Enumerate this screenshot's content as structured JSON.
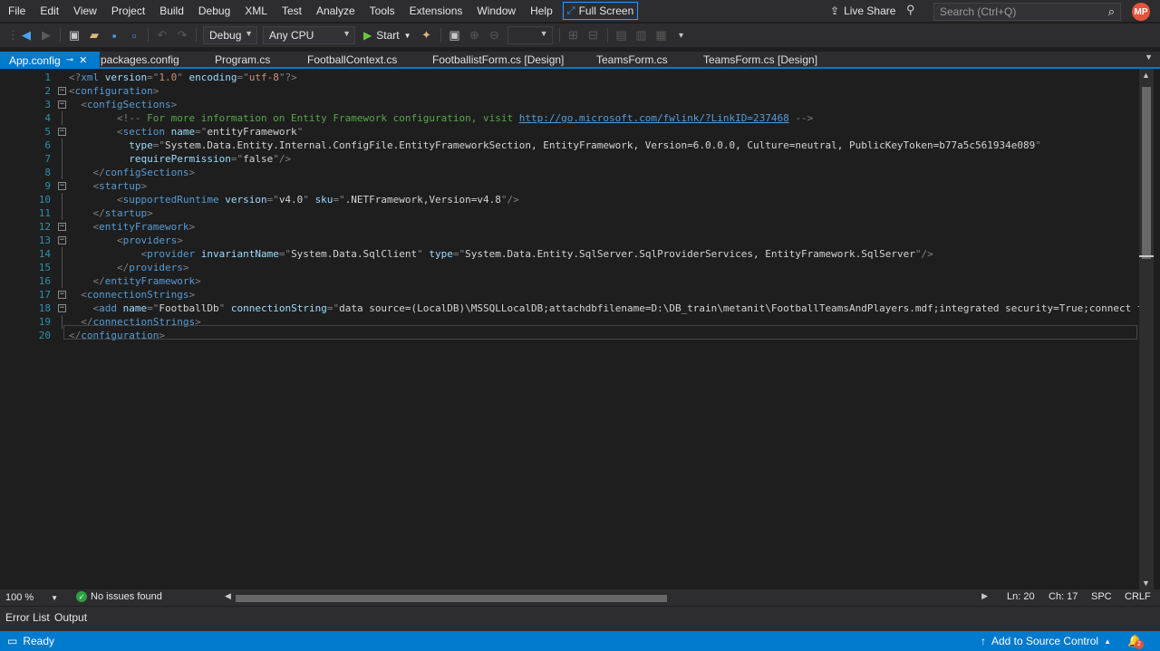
{
  "menu": {
    "items": [
      "File",
      "Edit",
      "View",
      "Project",
      "Build",
      "Debug",
      "XML",
      "Test",
      "Analyze",
      "Tools",
      "Extensions",
      "Window",
      "Help"
    ],
    "fullscreen": "Full Screen"
  },
  "liveshare": "Live Share",
  "search": {
    "placeholder": "Search (Ctrl+Q)"
  },
  "avatar": "MP",
  "toolbar": {
    "config": "Debug",
    "platform": "Any CPU",
    "start": "Start"
  },
  "tabs": [
    "App.config",
    "packages.config",
    "Program.cs",
    "FootballContext.cs",
    "FootballistForm.cs [Design]",
    "TeamsForm.cs",
    "TeamsForm.cs [Design]"
  ],
  "editor": {
    "lines": [
      [
        [
          "br",
          "<?"
        ],
        [
          "tag",
          "xml"
        ],
        [
          "pl",
          " "
        ],
        [
          "at",
          "version"
        ],
        [
          "br",
          "=\""
        ],
        [
          "vl",
          "1.0"
        ],
        [
          "br",
          "\" "
        ],
        [
          "at",
          "encoding"
        ],
        [
          "br",
          "=\""
        ],
        [
          "vl",
          "utf-8"
        ],
        [
          "br",
          "\"?>"
        ]
      ],
      [
        [
          "br",
          "<"
        ],
        [
          "tag",
          "configuration"
        ],
        [
          "br",
          ">"
        ]
      ],
      [
        [
          "pl",
          "  "
        ],
        [
          "br",
          "<"
        ],
        [
          "tag",
          "configSections"
        ],
        [
          "br",
          ">"
        ]
      ],
      [
        [
          "pl",
          "        "
        ],
        [
          "br",
          "<!-- "
        ],
        [
          "cm",
          "For more information on Entity Framework configuration, visit "
        ],
        [
          "lk",
          "http://go.microsoft.com/fwlink/?LinkID=237468"
        ],
        [
          "br",
          " -->"
        ]
      ],
      [
        [
          "pl",
          "        "
        ],
        [
          "br",
          "<"
        ],
        [
          "tag",
          "section"
        ],
        [
          "pl",
          " "
        ],
        [
          "at",
          "name"
        ],
        [
          "br",
          "=\""
        ],
        [
          "pl",
          "entityFramework"
        ],
        [
          "br",
          "\""
        ]
      ],
      [
        [
          "pl",
          "          "
        ],
        [
          "at",
          "type"
        ],
        [
          "br",
          "=\""
        ],
        [
          "pl",
          "System.Data.Entity.Internal.ConfigFile.EntityFrameworkSection, EntityFramework, Version=6.0.0.0, Culture=neutral, PublicKeyToken=b77a5c561934e089"
        ],
        [
          "br",
          "\""
        ]
      ],
      [
        [
          "pl",
          "          "
        ],
        [
          "at",
          "requirePermission"
        ],
        [
          "br",
          "=\""
        ],
        [
          "pl",
          "false"
        ],
        [
          "br",
          "\"/>"
        ]
      ],
      [
        [
          "pl",
          "    "
        ],
        [
          "br",
          "</"
        ],
        [
          "tag",
          "configSections"
        ],
        [
          "br",
          ">"
        ]
      ],
      [
        [
          "pl",
          "    "
        ],
        [
          "br",
          "<"
        ],
        [
          "tag",
          "startup"
        ],
        [
          "br",
          ">"
        ]
      ],
      [
        [
          "pl",
          "        "
        ],
        [
          "br",
          "<"
        ],
        [
          "tag",
          "supportedRuntime"
        ],
        [
          "pl",
          " "
        ],
        [
          "at",
          "version"
        ],
        [
          "br",
          "=\""
        ],
        [
          "pl",
          "v4.0"
        ],
        [
          "br",
          "\" "
        ],
        [
          "at",
          "sku"
        ],
        [
          "br",
          "=\""
        ],
        [
          "pl",
          ".NETFramework,Version=v4.8"
        ],
        [
          "br",
          "\"/>"
        ]
      ],
      [
        [
          "pl",
          "    "
        ],
        [
          "br",
          "</"
        ],
        [
          "tag",
          "startup"
        ],
        [
          "br",
          ">"
        ]
      ],
      [
        [
          "pl",
          "    "
        ],
        [
          "br",
          "<"
        ],
        [
          "tag",
          "entityFramework"
        ],
        [
          "br",
          ">"
        ]
      ],
      [
        [
          "pl",
          "        "
        ],
        [
          "br",
          "<"
        ],
        [
          "tag",
          "providers"
        ],
        [
          "br",
          ">"
        ]
      ],
      [
        [
          "pl",
          "            "
        ],
        [
          "br",
          "<"
        ],
        [
          "tag",
          "provider"
        ],
        [
          "pl",
          " "
        ],
        [
          "at",
          "invariantName"
        ],
        [
          "br",
          "=\""
        ],
        [
          "pl",
          "System.Data.SqlClient"
        ],
        [
          "br",
          "\" "
        ],
        [
          "at",
          "type"
        ],
        [
          "br",
          "=\""
        ],
        [
          "pl",
          "System.Data.Entity.SqlServer.SqlProviderServices, EntityFramework.SqlServer"
        ],
        [
          "br",
          "\"/>"
        ]
      ],
      [
        [
          "pl",
          "        "
        ],
        [
          "br",
          "</"
        ],
        [
          "tag",
          "providers"
        ],
        [
          "br",
          ">"
        ]
      ],
      [
        [
          "pl",
          "    "
        ],
        [
          "br",
          "</"
        ],
        [
          "tag",
          "entityFramework"
        ],
        [
          "br",
          ">"
        ]
      ],
      [
        [
          "pl",
          "  "
        ],
        [
          "br",
          "<"
        ],
        [
          "tag",
          "connectionStrings"
        ],
        [
          "br",
          ">"
        ]
      ],
      [
        [
          "pl",
          "    "
        ],
        [
          "br",
          "<"
        ],
        [
          "tag",
          "add"
        ],
        [
          "pl",
          " "
        ],
        [
          "at",
          "name"
        ],
        [
          "br",
          "=\""
        ],
        [
          "pl",
          "FootballDb"
        ],
        [
          "br",
          "\" "
        ],
        [
          "at",
          "connectionString"
        ],
        [
          "br",
          "=\""
        ],
        [
          "pl",
          "data source=(LocalDB)\\MSSQLLocalDB;attachdbfilename=D:\\DB_train\\metanit\\FootballTeamsAndPlayers.mdf;integrated security=True;connect ti"
        ]
      ],
      [
        [
          "pl",
          "  "
        ],
        [
          "br",
          "</"
        ],
        [
          "tag",
          "connectionStrings"
        ],
        [
          "br",
          ">"
        ]
      ],
      [
        [
          "br",
          "</"
        ],
        [
          "tag",
          "configuration"
        ],
        [
          "br",
          ">"
        ]
      ]
    ],
    "foldable": [
      2,
      3,
      5,
      9,
      12,
      13,
      17,
      18
    ]
  },
  "status": {
    "zoom": "100 %",
    "issues": "No issues found",
    "ln": "Ln: 20",
    "ch": "Ch: 17",
    "spc": "SPC",
    "crlf": "CRLF"
  },
  "bottom_tabs": [
    "Error List",
    "Output"
  ],
  "statusbar": {
    "ready": "Ready",
    "source_control": "Add to Source Control",
    "notifications": "2"
  }
}
